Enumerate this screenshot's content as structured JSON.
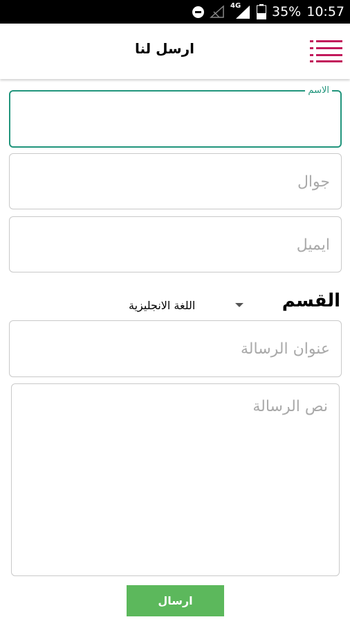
{
  "status_bar": {
    "network_type": "4G",
    "battery_percent": "35%",
    "time": "10:57"
  },
  "appbar": {
    "title": "ارسل لنا",
    "menu_icon": "hamburger-icon",
    "menu_color": "#c2185b"
  },
  "form": {
    "name": {
      "label": "الاسم",
      "value": ""
    },
    "mobile": {
      "placeholder": "جوال",
      "value": ""
    },
    "email": {
      "placeholder": "ايميل",
      "value": ""
    },
    "section": {
      "label": "القسم",
      "selected": "اللغة الانجليزية"
    },
    "subject": {
      "placeholder": "عنوان الرسالة",
      "value": ""
    },
    "message": {
      "placeholder": "نص الرسالة",
      "value": ""
    },
    "submit_label": "ارسال"
  },
  "colors": {
    "accent": "#21957c",
    "button": "#5cb85c",
    "menu": "#c2185b"
  }
}
